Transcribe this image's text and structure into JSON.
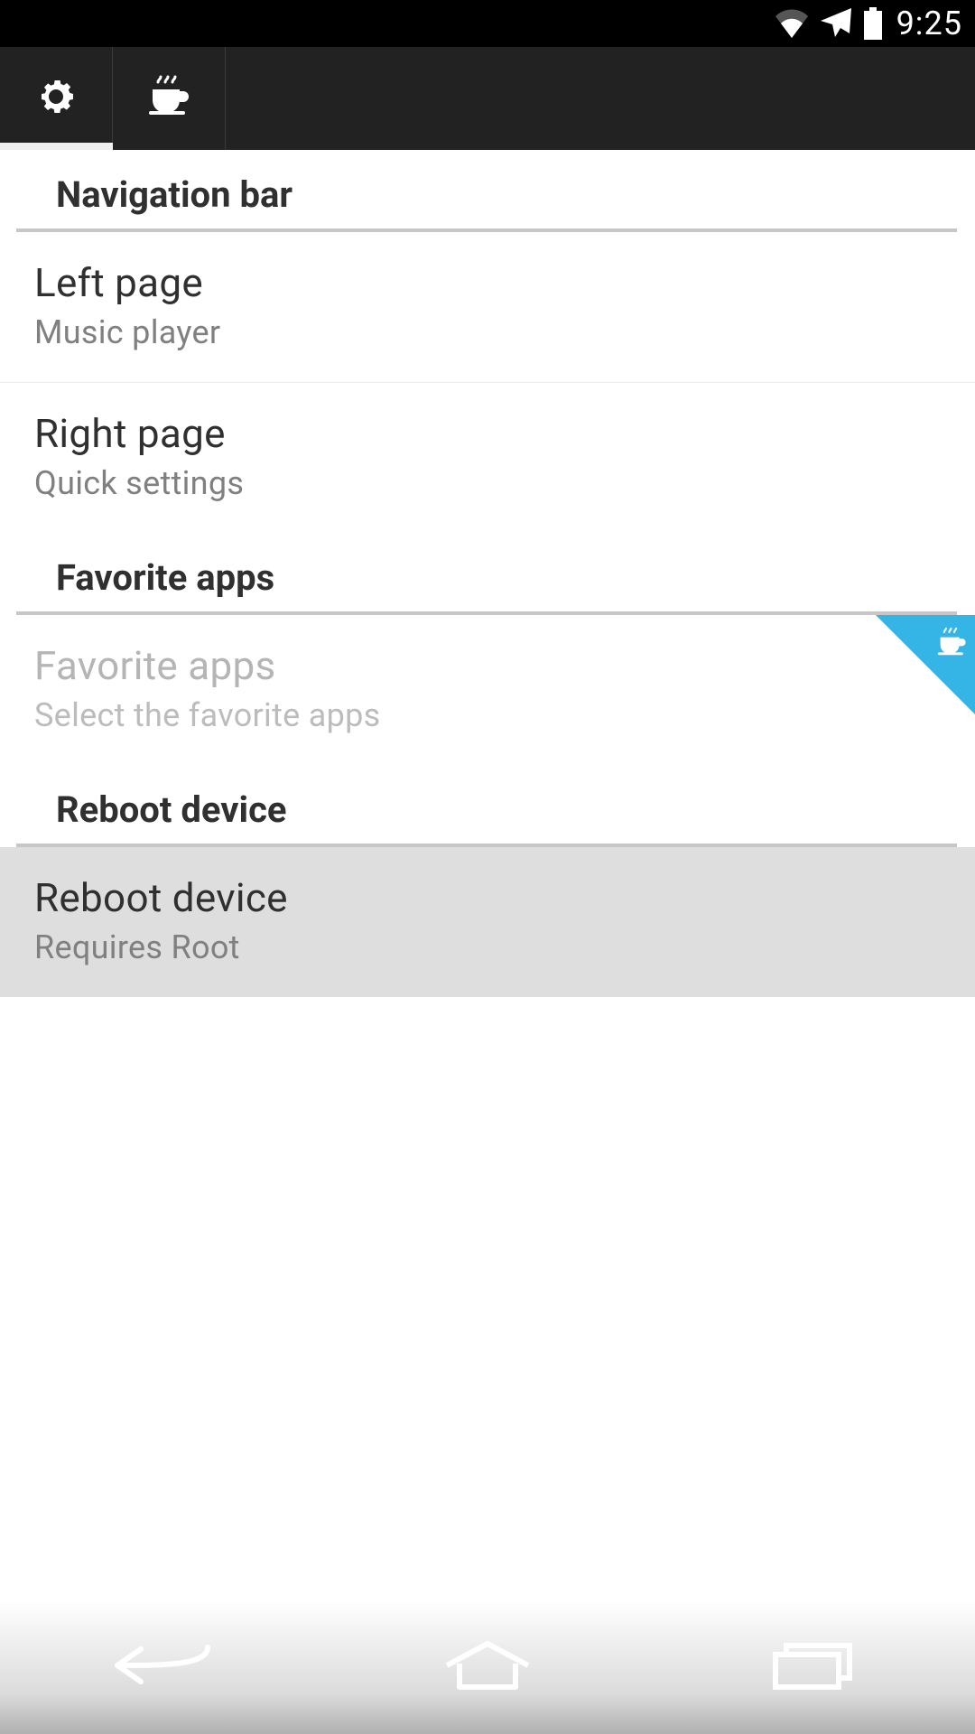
{
  "status_bar": {
    "time": "9:25"
  },
  "tabs": [
    {
      "icon": "gear-icon"
    },
    {
      "icon": "coffee-icon"
    }
  ],
  "sections": [
    {
      "header": "Navigation bar",
      "items": [
        {
          "title": "Left page",
          "sub": "Music player"
        },
        {
          "title": "Right page",
          "sub": "Quick settings"
        }
      ]
    },
    {
      "header": "Favorite apps",
      "items": [
        {
          "title": "Favorite apps",
          "sub": "Select the favorite apps",
          "disabled": true,
          "badge": true
        }
      ]
    },
    {
      "header": "Reboot device",
      "items": [
        {
          "title": "Reboot device",
          "sub": "Requires Root",
          "selected": true
        }
      ]
    }
  ]
}
